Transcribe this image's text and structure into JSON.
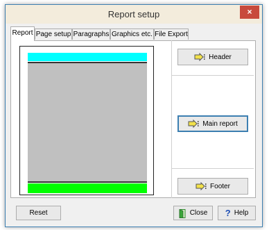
{
  "window": {
    "title": "Report setup",
    "close_glyph": "×"
  },
  "tabs": [
    {
      "label": "Report",
      "active": true
    },
    {
      "label": "Page setup",
      "active": false
    },
    {
      "label": "Paragraphs",
      "active": false
    },
    {
      "label": "Graphics etc.",
      "active": false
    },
    {
      "label": "File Export",
      "active": false
    }
  ],
  "sections": {
    "header_label": "Header",
    "main_label": "Main report",
    "footer_label": "Footer"
  },
  "preview_colors": {
    "header": "#00ffff",
    "main": "#c0c0c0",
    "footer": "#00ff00"
  },
  "buttons": {
    "reset_label": "Reset",
    "close_label": "Close",
    "help_label": "Help"
  },
  "icons": {
    "section": "section-pointer-icon",
    "close": "exit-door-icon",
    "help": "question-mark-icon"
  }
}
